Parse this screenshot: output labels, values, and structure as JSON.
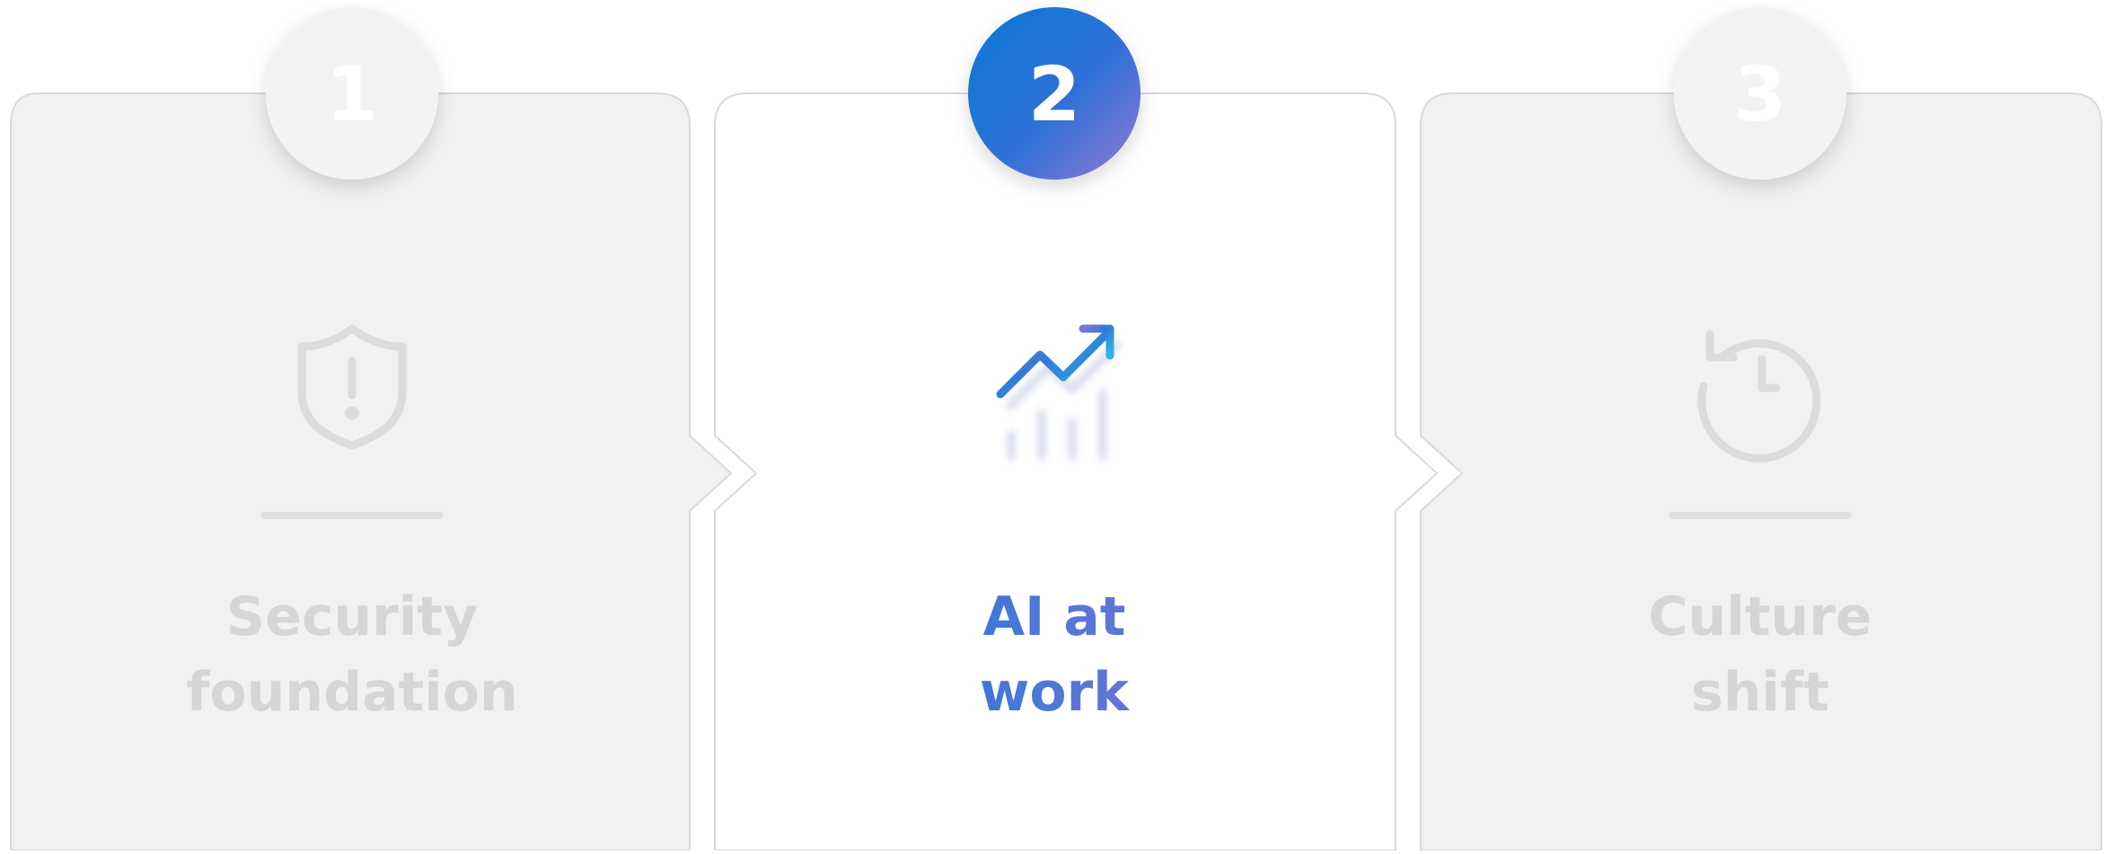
{
  "steps": [
    {
      "number": "1",
      "title_line1": "Security",
      "title_line2": "foundation",
      "icon": "shield-alert-icon",
      "state": "inactive"
    },
    {
      "number": "2",
      "title_line1": "AI at",
      "title_line2": "work",
      "icon": "chart-trend-up-icon",
      "state": "active"
    },
    {
      "number": "3",
      "title_line1": "Culture",
      "title_line2": "shift",
      "icon": "history-clock-icon",
      "state": "inactive"
    }
  ],
  "colors": {
    "inactive_card": "#f1f1f1",
    "inactive_circle": "#f3f3f5",
    "inactive_content": "#dcdcdc",
    "active_card": "#ffffff",
    "active_blue": "#0a78d8",
    "active_purple": "#8a6fd0",
    "active_cyan": "#40d0f0",
    "border": "#d9d9d9"
  }
}
